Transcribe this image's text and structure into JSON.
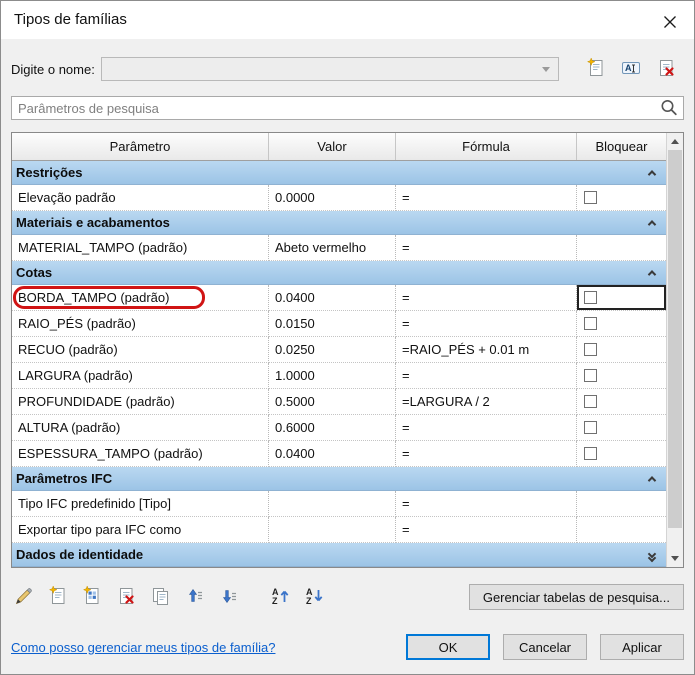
{
  "window": {
    "title": "Tipos de famílias",
    "close_icon": "close-x"
  },
  "name_field": {
    "label": "Digite o nome:",
    "value": "",
    "buttons": [
      {
        "name": "new-type",
        "icon": "page-star"
      },
      {
        "name": "rename-type",
        "icon": "rename"
      },
      {
        "name": "delete-type",
        "icon": "page-delete"
      }
    ]
  },
  "search": {
    "placeholder": "Parâmetros de pesquisa",
    "icon": "magnifier"
  },
  "table": {
    "columns": [
      "Parâmetro",
      "Valor",
      "Fórmula",
      "Bloquear"
    ],
    "sections": [
      {
        "title": "Restrições",
        "collapsed": false,
        "rows": [
          {
            "param": "Elevação padrão",
            "value": "0.0000",
            "formula": "=",
            "lock": true
          }
        ]
      },
      {
        "title": "Materiais e acabamentos",
        "collapsed": false,
        "rows": [
          {
            "param": "MATERIAL_TAMPO (padrão)",
            "value": "Abeto vermelho",
            "formula": "=",
            "lock": false
          }
        ]
      },
      {
        "title": "Cotas",
        "collapsed": false,
        "rows": [
          {
            "param": "BORDA_TAMPO (padrão)",
            "value": "0.0400",
            "formula": "=",
            "lock": true,
            "annotated": true,
            "lock_selected": true
          },
          {
            "param": "RAIO_PÉS (padrão)",
            "value": "0.0150",
            "formula": "=",
            "lock": true
          },
          {
            "param": "RECUO (padrão)",
            "value": "0.0250",
            "formula": "=RAIO_PÉS + 0.01 m",
            "lock": true
          },
          {
            "param": "LARGURA (padrão)",
            "value": "1.0000",
            "formula": "=",
            "lock": true
          },
          {
            "param": "PROFUNDIDADE (padrão)",
            "value": "0.5000",
            "formula": "=LARGURA / 2",
            "lock": true
          },
          {
            "param": "ALTURA (padrão)",
            "value": "0.6000",
            "formula": "=",
            "lock": true
          },
          {
            "param": "ESPESSURA_TAMPO (padrão)",
            "value": "0.0400",
            "formula": "=",
            "lock": true
          }
        ]
      },
      {
        "title": "Parâmetros IFC",
        "collapsed": false,
        "rows": [
          {
            "param": "Tipo IFC predefinido [Tipo]",
            "value": "",
            "formula": "=",
            "lock": false
          },
          {
            "param": "Exportar tipo para IFC como",
            "value": "",
            "formula": "=",
            "lock": false
          }
        ]
      },
      {
        "title": "Dados de identidade",
        "collapsed": true,
        "rows": []
      }
    ]
  },
  "toolbar": {
    "buttons": [
      {
        "name": "edit-parameter",
        "icon": "pencil"
      },
      {
        "name": "new-parameter",
        "icon": "page-star"
      },
      {
        "name": "associate-parameter",
        "icon": "page-grid"
      },
      {
        "name": "delete-parameter",
        "icon": "page-delete"
      },
      {
        "name": "duplicate-parameter",
        "icon": "pages-copy"
      },
      {
        "name": "move-up",
        "icon": "arrow-up-lines"
      },
      {
        "name": "move-down",
        "icon": "arrow-down-lines"
      },
      {
        "name": "sort-ascending",
        "icon": "sort-az-up"
      },
      {
        "name": "sort-descending",
        "icon": "sort-az-down"
      }
    ],
    "manage_lookup_tables": "Gerenciar tabelas de pesquisa..."
  },
  "footer": {
    "help_link": "Como posso gerenciar meus tipos de família?",
    "ok": "OK",
    "cancel": "Cancelar",
    "apply": "Aplicar"
  },
  "colors": {
    "section_header_blue": "#a6cbe9",
    "annotation_red": "#d01414",
    "link_blue": "#0b5fce",
    "focus_blue": "#0078d7"
  }
}
